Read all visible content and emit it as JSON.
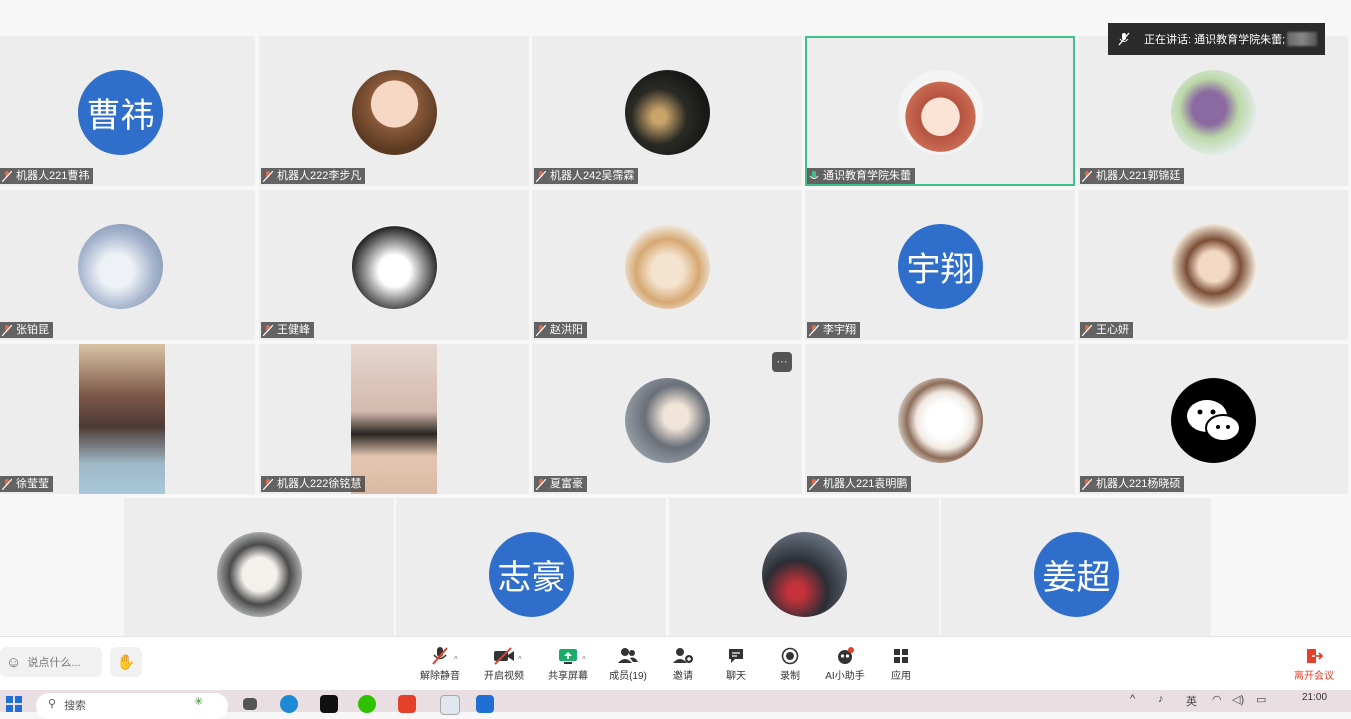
{
  "speaking": {
    "label": "正在讲话: 通识教育学院朱蕾;"
  },
  "tiles": [
    {
      "name": "机器人221曹祎",
      "avatar_text": "曹祎"
    },
    {
      "name": "机器人222李步凡"
    },
    {
      "name": "机器人242吴霈霖"
    },
    {
      "name": "通识教育学院朱蕾"
    },
    {
      "name": "机器人221郭锦廷"
    },
    {
      "name": "张铂昆"
    },
    {
      "name": "王健峰"
    },
    {
      "name": "赵洪阳"
    },
    {
      "name": "李宇翔",
      "avatar_text": "宇翔"
    },
    {
      "name": "王心妍"
    },
    {
      "name": "徐莹莹"
    },
    {
      "name": "机器人222徐铭慧"
    },
    {
      "name": "夏富豪"
    },
    {
      "name": "机器人221袁明鹏"
    },
    {
      "name": "机器人221杨晓硕"
    },
    {
      "name": ""
    },
    {
      "name": "",
      "avatar_text": "志豪"
    },
    {
      "name": ""
    },
    {
      "name": "",
      "avatar_text": "姜超"
    }
  ],
  "toolbar": {
    "chat_placeholder": "说点什么...",
    "unmute": "解除静音",
    "start_video": "开启视频",
    "share_screen": "共享屏幕",
    "members": "成员(19)",
    "invite": "邀请",
    "chat": "聊天",
    "record": "录制",
    "ai_assistant": "AI小助手",
    "apps": "应用",
    "leave": "离开会议"
  },
  "taskbar": {
    "search": "搜索",
    "ime": "英",
    "time": "21:00"
  },
  "colors": {
    "avatar_blue": "#2f6fcb",
    "active_border": "#3fc28a",
    "leave_red": "#e5402a"
  }
}
